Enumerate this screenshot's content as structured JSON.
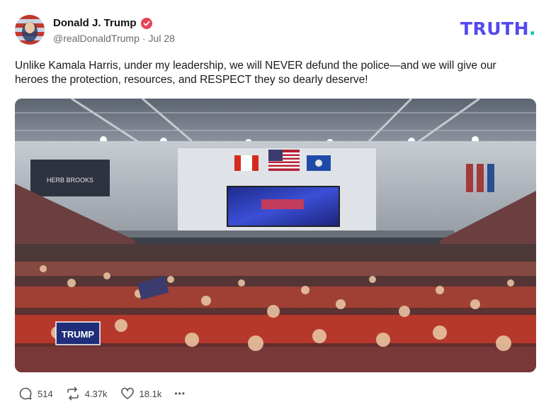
{
  "author": {
    "name": "Donald J. Trump",
    "handle": "@realDonaldTrump",
    "separator": "·",
    "date": "Jul 28"
  },
  "brand": {
    "logo_text": "TRUTH",
    "logo_dot": "."
  },
  "post": {
    "text": "Unlike Kamala Harris, under my leadership, we will NEVER defund the police—and we will give our heroes the protection, resources, and RESPECT they so dearly deserve!"
  },
  "media": {
    "banner_text": "HERB BROOKS",
    "sign_text": "TRUMP"
  },
  "actions": {
    "replies": "514",
    "retruths": "4.37k",
    "likes": "18.1k",
    "more": "•••"
  },
  "colors": {
    "accent": "#5448ee",
    "accent_secondary": "#00c7b0",
    "verified": "#e8435a"
  }
}
